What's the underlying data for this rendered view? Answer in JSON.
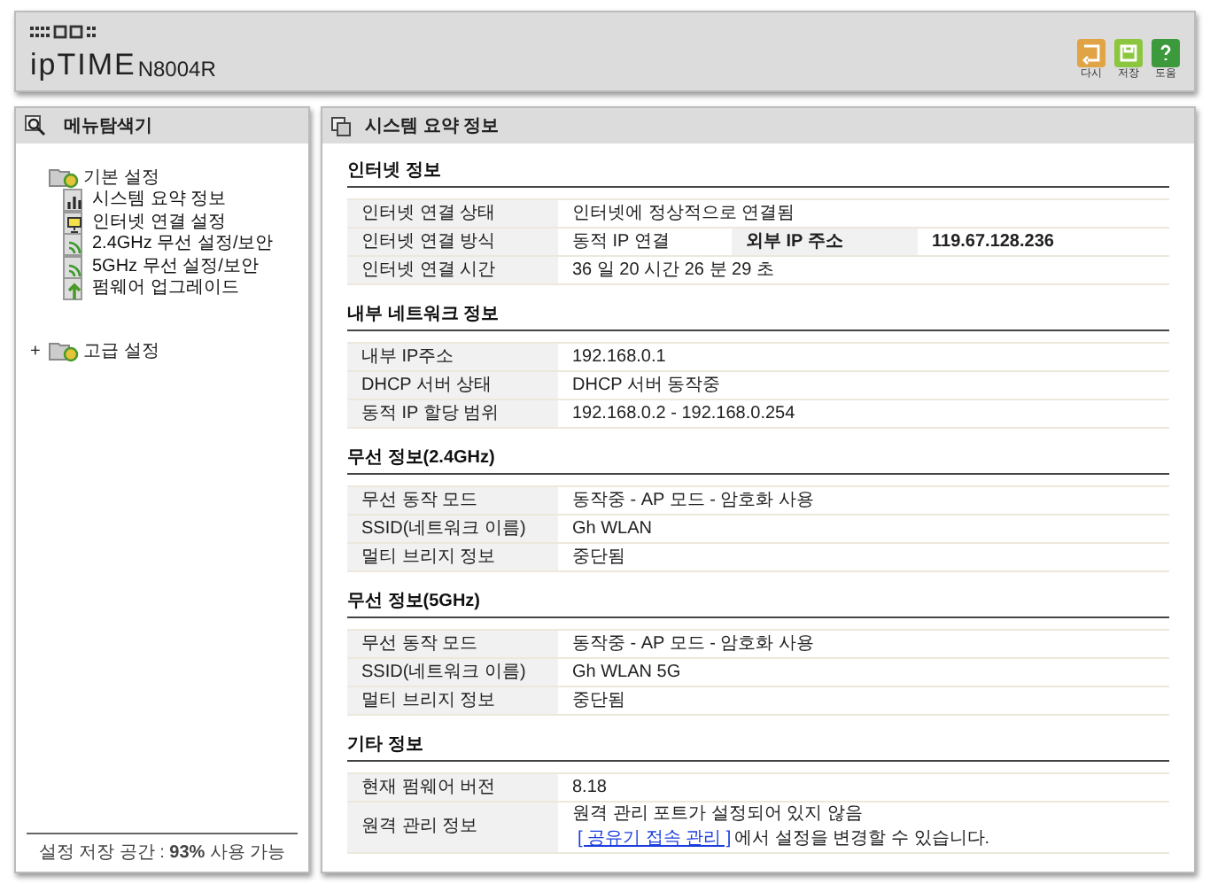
{
  "header": {
    "brand": "ipTIME",
    "model": "N8004R",
    "buttons": [
      {
        "kind": "reload",
        "label": "다시"
      },
      {
        "kind": "save",
        "label": "저장"
      },
      {
        "kind": "help",
        "label": "도움"
      }
    ]
  },
  "sidebar": {
    "title": "메뉴탐색기",
    "tree": [
      {
        "label": "기본 설정",
        "expanded": true,
        "children": [
          {
            "kind": "chart",
            "label": "시스템 요약 정보"
          },
          {
            "kind": "monitor",
            "label": "인터넷 연결 설정"
          },
          {
            "kind": "wifi",
            "label": "2.4GHz 무선 설정/보안"
          },
          {
            "kind": "wifi",
            "label": "5GHz 무선 설정/보안"
          },
          {
            "kind": "upgrade",
            "label": "펌웨어 업그레이드"
          }
        ]
      },
      {
        "label": "고급 설정",
        "expanded": false,
        "toggle": "+"
      }
    ],
    "storage": "설정 저장 공간 : **93%** 사용 가능"
  },
  "main": {
    "title": "시스템 요약 정보",
    "sections": [
      {
        "title": "인터넷 정보",
        "rows": [
          {
            "label": "인터넷 연결 상태",
            "value": "인터넷에 정상적으로 연결됨"
          },
          {
            "label": "인터넷 연결 방식",
            "value": "동적 IP 연결",
            "extra_label": "외부 IP 주소",
            "extra_value": "119.67.128.236"
          },
          {
            "label": "인터넷 연결 시간",
            "value": "36 일 20 시간 26 분 29 초"
          }
        ]
      },
      {
        "title": "내부 네트워크 정보",
        "rows": [
          {
            "label": "내부 IP주소",
            "value": "192.168.0.1"
          },
          {
            "label": "DHCP 서버 상태",
            "value": "DHCP 서버 동작중"
          },
          {
            "label": "동적 IP 할당 범위",
            "value": "192.168.0.2 -  192.168.0.254"
          }
        ]
      },
      {
        "title": "무선 정보(2.4GHz)",
        "rows": [
          {
            "label": "무선 동작 모드",
            "value": "동작중 - AP 모드 - 암호화 사용"
          },
          {
            "label": "SSID(네트워크 이름)",
            "value": "Gh WLAN"
          },
          {
            "label": "멀티 브리지 정보",
            "value": "중단됨"
          }
        ]
      },
      {
        "title": "무선 정보(5GHz)",
        "rows": [
          {
            "label": "무선 동작 모드",
            "value": "동작중 - AP 모드 - 암호화 사용"
          },
          {
            "label": "SSID(네트워크 이름)",
            "value": "Gh WLAN 5G"
          },
          {
            "label": "멀티 브리지 정보",
            "value": "중단됨"
          }
        ]
      },
      {
        "title": "기타 정보",
        "rows": [
          {
            "label": "현재 펌웨어 버전",
            "value": "8.18"
          },
          {
            "label": "원격 관리 정보",
            "value": "원격 관리 포트가 설정되어 있지 않음",
            "link": "[ 공유기 접속 관리 ]",
            "link_after": "에서 설정을 변경할 수 있습니다."
          }
        ]
      }
    ]
  }
}
